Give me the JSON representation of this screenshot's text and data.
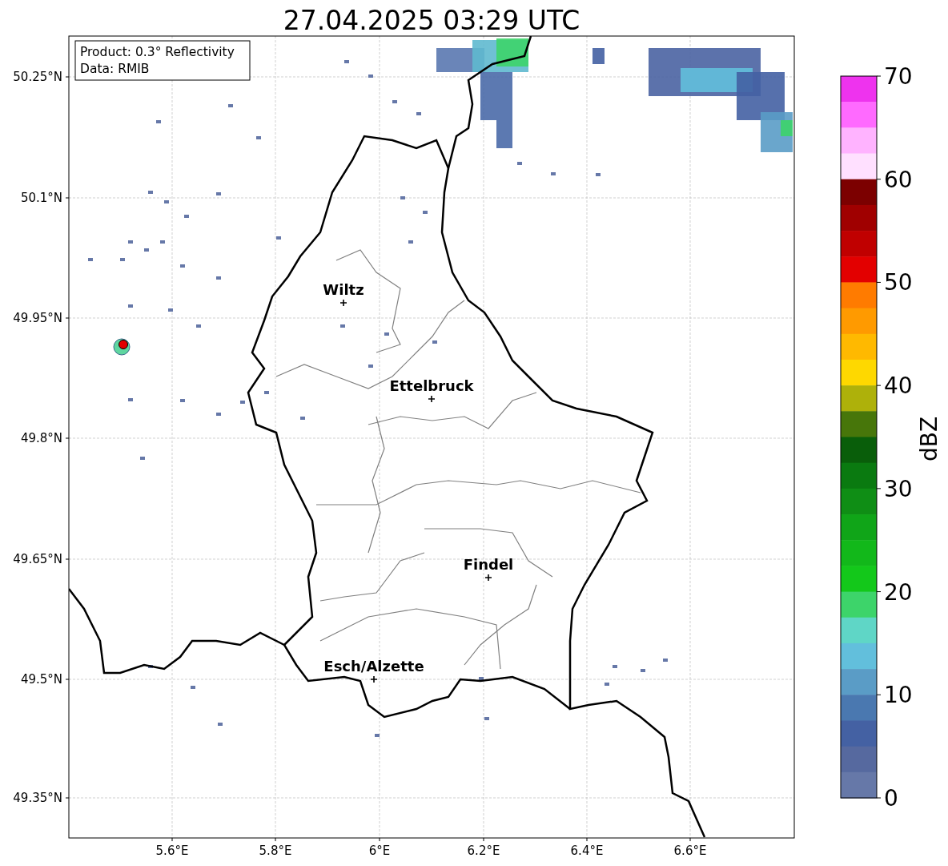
{
  "title": "27.04.2025 03:29 UTC",
  "info_box": [
    "Product: 0.3° Reflectivity",
    "Data: RMIB"
  ],
  "map": {
    "lat_labels": [
      "50.25°N",
      "50.1°N",
      "49.95°N",
      "49.8°N",
      "49.65°N",
      "49.5°N",
      "49.35°N"
    ],
    "lon_labels": [
      "5.6°E",
      "5.8°E",
      "6°E",
      "6.2°E",
      "6.4°E",
      "6.6°E"
    ],
    "cities": [
      {
        "name": "Wiltz"
      },
      {
        "name": "Ettelbruck"
      },
      {
        "name": "Findel"
      },
      {
        "name": "Esch/Alzette"
      }
    ]
  },
  "colorbar": {
    "label": "dBZ",
    "ticks": [
      "70",
      "60",
      "50",
      "40",
      "30",
      "20",
      "10",
      "0"
    ],
    "colors": [
      {
        "color": "#ee33ee"
      },
      {
        "color": "#ff6aff"
      },
      {
        "color": "#ffb3ff"
      },
      {
        "color": "#ffe0ff"
      },
      {
        "color": "#7c0000"
      },
      {
        "color": "#a00000"
      },
      {
        "color": "#c00000"
      },
      {
        "color": "#e30000"
      },
      {
        "color": "#ff7b00"
      },
      {
        "color": "#ff9a00"
      },
      {
        "color": "#ffb900"
      },
      {
        "color": "#fed800"
      },
      {
        "color": "#aeb10a"
      },
      {
        "color": "#47760a"
      },
      {
        "color": "#095e0a"
      },
      {
        "color": "#0a7a10"
      },
      {
        "color": "#0f8e15"
      },
      {
        "color": "#10a518"
      },
      {
        "color": "#12b81a"
      },
      {
        "color": "#13c81a"
      },
      {
        "color": "#3dd46a"
      },
      {
        "color": "#5fd6c6"
      },
      {
        "color": "#62bfdc"
      },
      {
        "color": "#5a9cc6"
      },
      {
        "color": "#4a78b0"
      },
      {
        "color": "#4461a3"
      },
      {
        "color": "#56699f"
      },
      {
        "color": "#6678a8"
      }
    ]
  }
}
